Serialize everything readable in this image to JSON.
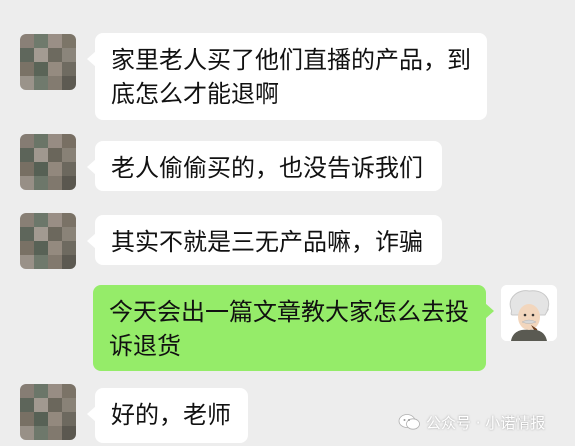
{
  "messages": [
    {
      "side": "left",
      "text": "家里老人买了他们直播的产品，到底怎么才能退啊"
    },
    {
      "side": "left",
      "text": "老人偷偷买的，也没告诉我们"
    },
    {
      "side": "left",
      "text": "其实不就是三无产品嘛，诈骗"
    },
    {
      "side": "right",
      "text": "今天会出一篇文章教大家怎么去投诉退货"
    },
    {
      "side": "left",
      "text": "好的，老师"
    }
  ],
  "watermark": {
    "text": "公众号 · 小诺情报",
    "icon": "wechat-official-account-icon"
  },
  "colors": {
    "background": "#ededed",
    "incoming_bubble": "#ffffff",
    "outgoing_bubble": "#95ec69"
  }
}
